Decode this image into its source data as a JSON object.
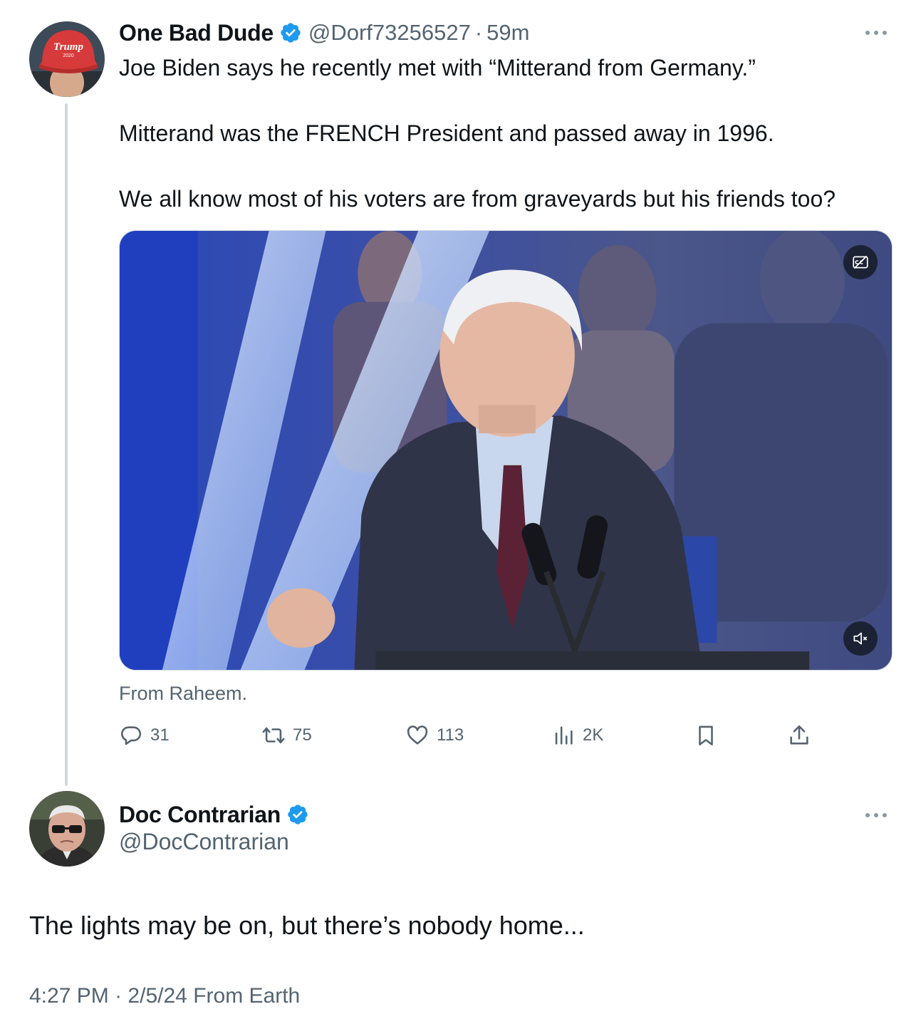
{
  "tweet1": {
    "display_name": "One Bad Dude",
    "handle": "@Dorf73256527",
    "separator": "·",
    "time": "59m",
    "avatar_hat_text": "Trump",
    "avatar_hat_year": "2020",
    "text_lines": [
      "Joe Biden says he recently met with “Mitterand from Germany.”",
      "Mitterand was the FRENCH President and passed away in 1996.",
      "We all know most of his voters are from graveyards but his friends too?"
    ],
    "media_caption": "From Raheem.",
    "actions": {
      "reply_count": "31",
      "retweet_count": "75",
      "like_count": "113",
      "views_count": "2K"
    }
  },
  "tweet2": {
    "display_name": "Doc Contrarian",
    "handle": "@DocContrarian",
    "text": "The lights may be on, but there’s nobody home...",
    "time": "4:27 PM",
    "separator": "·",
    "date": "2/5/24",
    "source": "From Earth"
  },
  "colors": {
    "verified_blue": "#1d9bf0",
    "secondary_text": "#536471",
    "thread_line": "#cfd9de"
  },
  "icons": {
    "verified": "verified-badge-icon",
    "more": "more-dots-icon",
    "reply": "reply-bubble-icon",
    "retweet": "retweet-icon",
    "like": "heart-icon",
    "views": "views-bars-icon",
    "bookmark": "bookmark-icon",
    "share": "share-upload-icon",
    "captions": "captions-off-icon",
    "mute": "muted-speaker-icon"
  }
}
